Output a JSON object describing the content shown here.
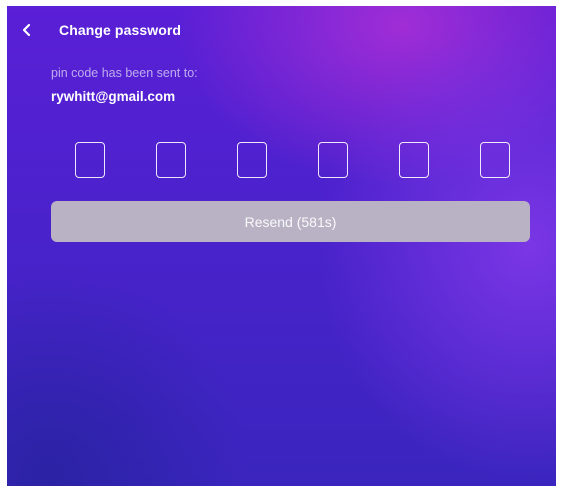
{
  "header": {
    "back_icon": "chevron-left-icon",
    "title": "Change password"
  },
  "message": {
    "sent_label": "pin code has been sent to:",
    "email": "rywhitt@gmail.com"
  },
  "pin": {
    "length": 6,
    "values": [
      "",
      "",
      "",
      "",
      "",
      ""
    ]
  },
  "resend": {
    "label": "Resend (581s)",
    "enabled": false
  },
  "colors": {
    "background_top": "#5a1fd6",
    "background_bottom": "#3a25be",
    "accent_glow": "#a42ed6",
    "resend_button": "#b8b2c4",
    "text": "#ffffff"
  }
}
